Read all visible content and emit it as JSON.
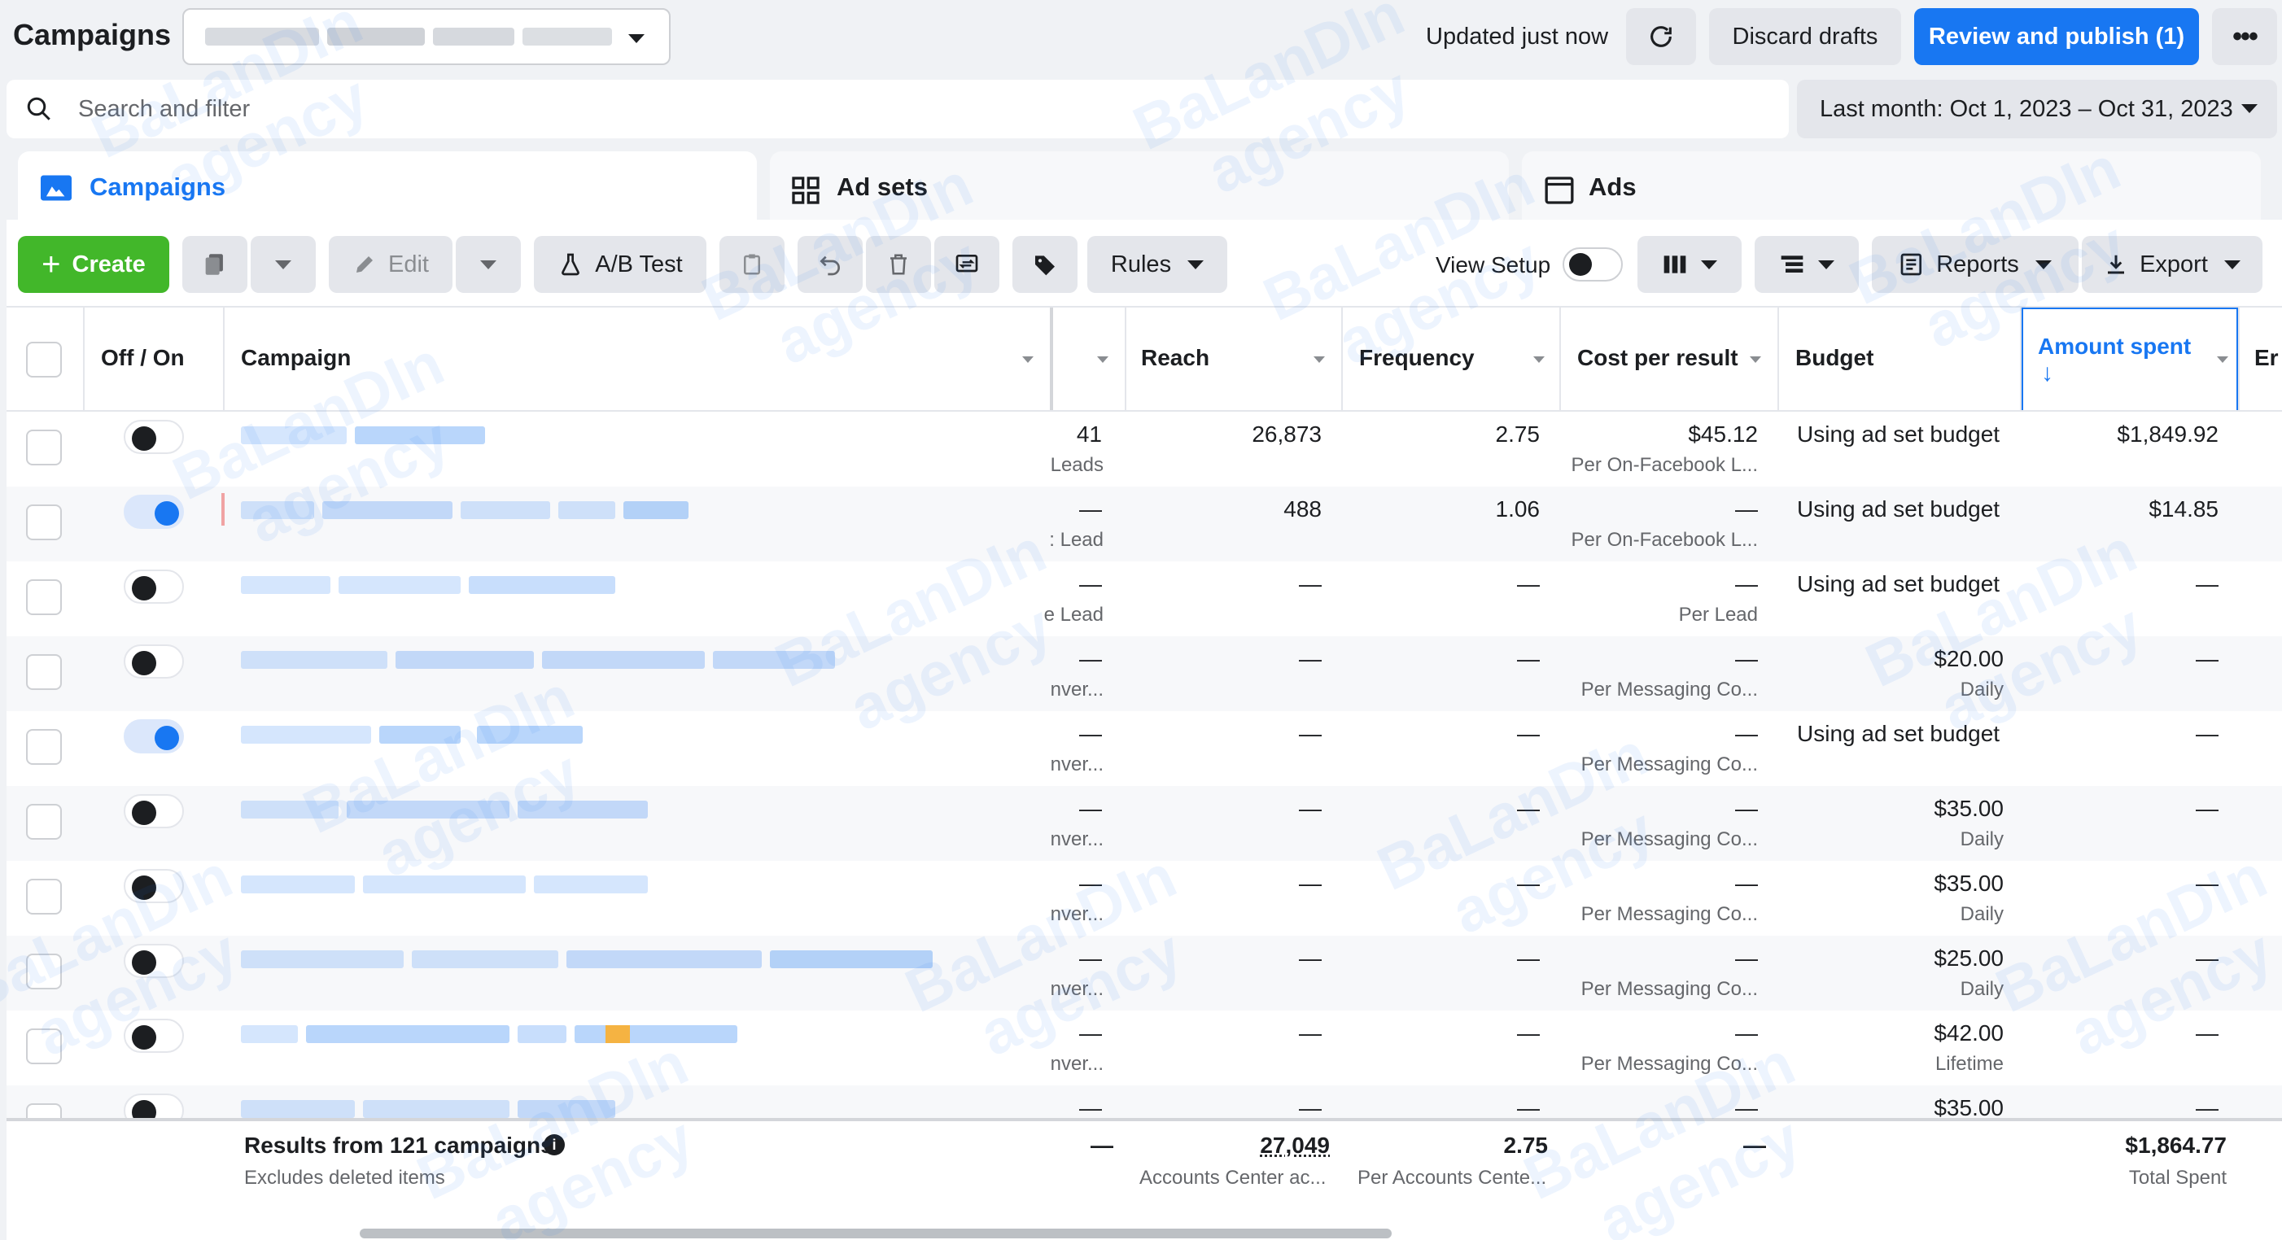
{
  "header": {
    "title": "Campaigns",
    "updated": "Updated just now",
    "discard": "Discard drafts",
    "review": "Review and publish (1)"
  },
  "search": {
    "placeholder": "Search and filter"
  },
  "date_range": "Last month: Oct 1, 2023 – Oct 31, 2023",
  "tabs": [
    {
      "label": "Campaigns"
    },
    {
      "label": "Ad sets"
    },
    {
      "label": "Ads"
    }
  ],
  "toolbar": {
    "create": "Create",
    "edit": "Edit",
    "ab_test": "A/B Test",
    "rules": "Rules",
    "view_setup": "View Setup",
    "reports": "Reports",
    "export": "Export"
  },
  "columns": {
    "off_on": "Off / On",
    "campaign": "Campaign",
    "reach": "Reach",
    "frequency": "Frequency",
    "cost_per_result": "Cost per result",
    "budget": "Budget",
    "amount_spent": "Amount spent",
    "next": "Er"
  },
  "rows": [
    {
      "on": false,
      "results": "41",
      "results_sub": "Leads",
      "reach": "26,873",
      "freq": "2.75",
      "cpr": "$45.12",
      "cpr_sub": "Per On-Facebook L...",
      "budget": "Using ad set budget",
      "budget_sub": "",
      "spent": "$1,849.92"
    },
    {
      "on": true,
      "results": "—",
      "results_sub": ": Lead",
      "reach": "488",
      "freq": "1.06",
      "cpr": "—",
      "cpr_sub": "Per On-Facebook L...",
      "budget": "Using ad set budget",
      "budget_sub": "",
      "spent": "$14.85"
    },
    {
      "on": false,
      "results": "—",
      "results_sub": "e Lead",
      "reach": "—",
      "freq": "—",
      "cpr": "—",
      "cpr_sub": "Per Lead",
      "budget": "Using ad set budget",
      "budget_sub": "",
      "spent": "—"
    },
    {
      "on": false,
      "results": "—",
      "results_sub": "nver...",
      "reach": "—",
      "freq": "—",
      "cpr": "—",
      "cpr_sub": "Per Messaging Co...",
      "budget": "$20.00",
      "budget_sub": "Daily",
      "spent": "—"
    },
    {
      "on": true,
      "results": "—",
      "results_sub": "nver...",
      "reach": "—",
      "freq": "—",
      "cpr": "—",
      "cpr_sub": "Per Messaging Co...",
      "budget": "Using ad set budget",
      "budget_sub": "",
      "spent": "—"
    },
    {
      "on": false,
      "results": "—",
      "results_sub": "nver...",
      "reach": "—",
      "freq": "—",
      "cpr": "—",
      "cpr_sub": "Per Messaging Co...",
      "budget": "$35.00",
      "budget_sub": "Daily",
      "spent": "—"
    },
    {
      "on": false,
      "results": "—",
      "results_sub": "nver...",
      "reach": "—",
      "freq": "—",
      "cpr": "—",
      "cpr_sub": "Per Messaging Co...",
      "budget": "$35.00",
      "budget_sub": "Daily",
      "spent": "—"
    },
    {
      "on": false,
      "results": "—",
      "results_sub": "nver...",
      "reach": "—",
      "freq": "—",
      "cpr": "—",
      "cpr_sub": "Per Messaging Co...",
      "budget": "$25.00",
      "budget_sub": "Daily",
      "spent": "—"
    },
    {
      "on": false,
      "results": "—",
      "results_sub": "nver...",
      "reach": "—",
      "freq": "—",
      "cpr": "—",
      "cpr_sub": "Per Messaging Co...",
      "budget": "$42.00",
      "budget_sub": "Lifetime",
      "spent": "—"
    },
    {
      "on": false,
      "results": "—",
      "results_sub": "",
      "reach": "—",
      "freq": "—",
      "cpr": "—",
      "cpr_sub": "",
      "budget": "$35.00",
      "budget_sub": "",
      "spent": "—"
    }
  ],
  "totals": {
    "label": "Results from 121 campaigns",
    "sub": "Excludes deleted items",
    "results": "—",
    "reach": "27,049",
    "reach_sub": "Accounts Center ac...",
    "freq": "2.75",
    "freq_sub": "Per Accounts Cente...",
    "cpr": "—",
    "spent": "$1,864.77",
    "spent_sub": "Total Spent"
  },
  "watermark": [
    "BaLanDIn",
    "agency"
  ],
  "colors": {
    "accent": "#1877f2",
    "create": "#42b72a"
  }
}
